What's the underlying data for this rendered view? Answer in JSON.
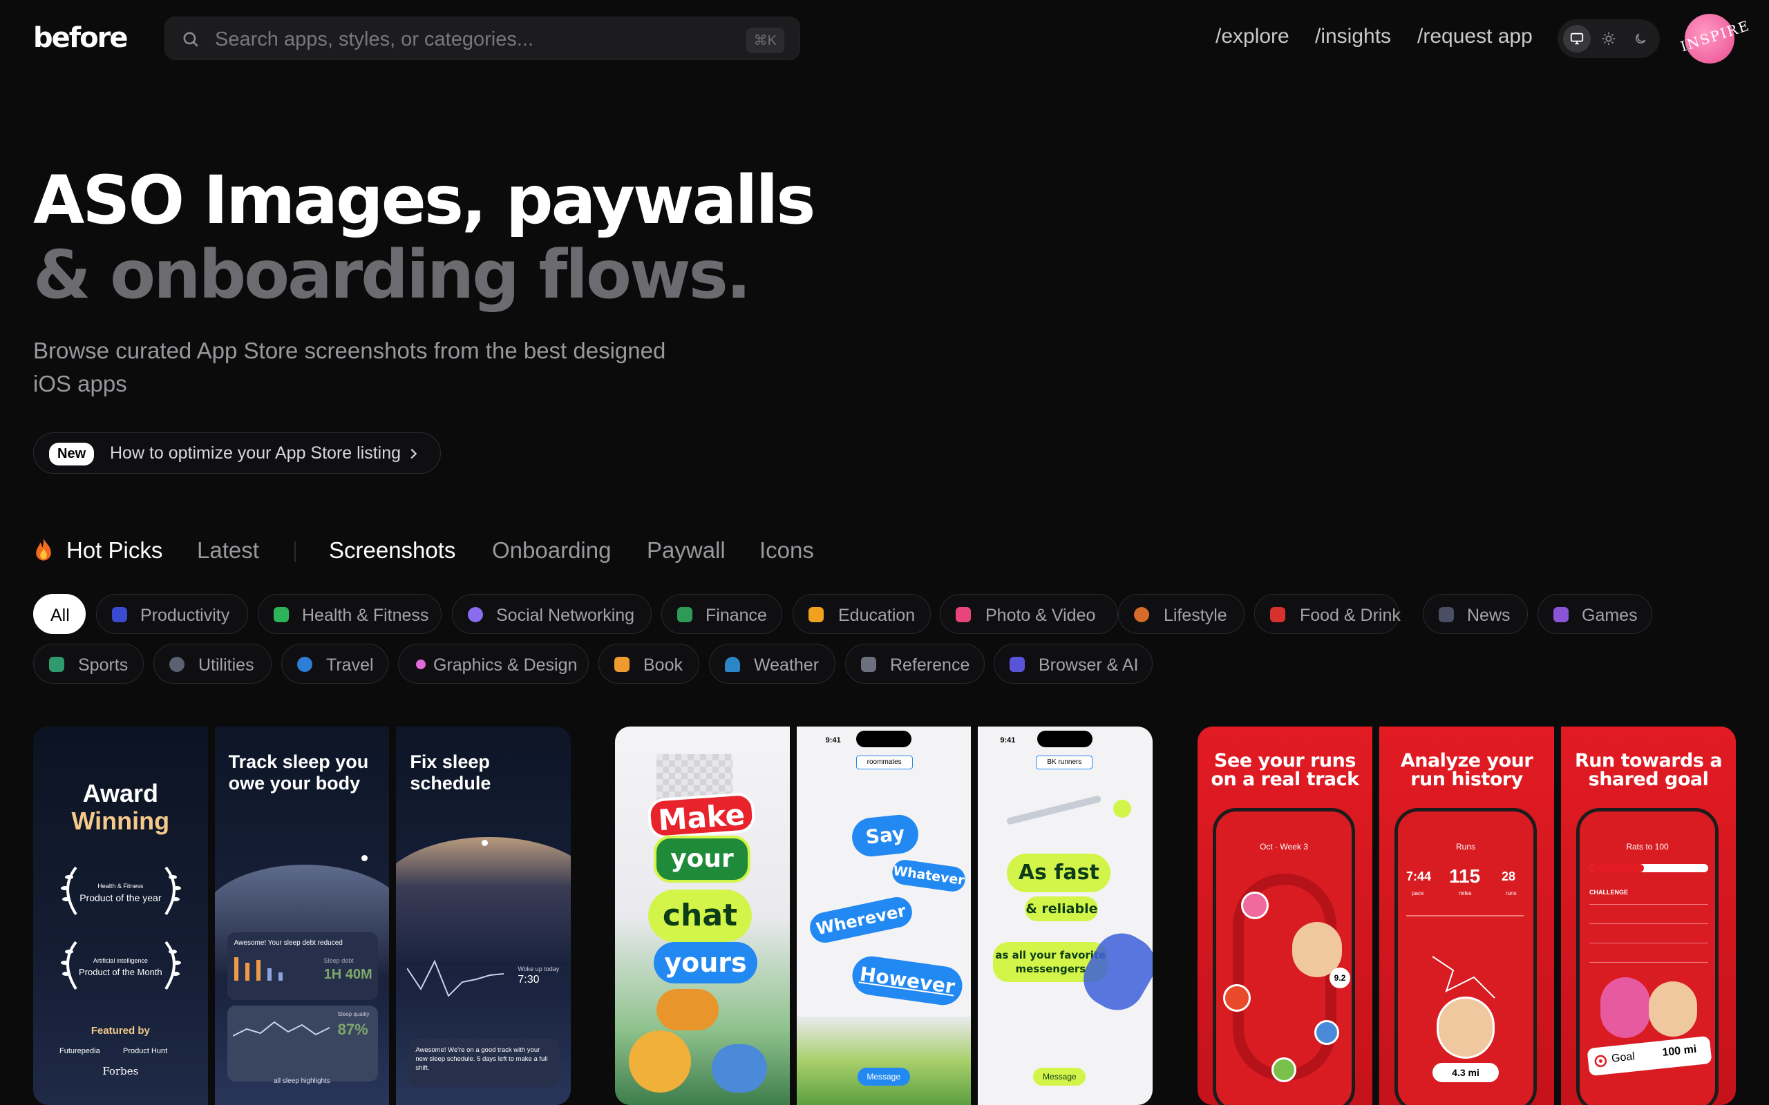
{
  "header": {
    "logo": "before",
    "search_placeholder": "Search apps, styles, or categories...",
    "shortcut": "⌘K",
    "nav": [
      "/explore",
      "/insights",
      "/request app"
    ],
    "avatar_text": "INSPIRE"
  },
  "hero": {
    "title_line1": "ASO Images, paywalls",
    "title_line2": "& onboarding flows.",
    "subtitle_line1": "Browse curated App Store screenshots from the best designed",
    "subtitle_line2": "iOS apps",
    "pill_badge": "New",
    "pill_text": "How to optimize your App Store listing"
  },
  "tabs": {
    "hot": "Hot Picks",
    "latest": "Latest",
    "screenshots": "Screenshots",
    "onboarding": "Onboarding",
    "paywall": "Paywall",
    "icons": "Icons"
  },
  "categories": {
    "all": "All",
    "productivity": "Productivity",
    "health": "Health & Fitness",
    "social": "Social Networking",
    "finance": "Finance",
    "education": "Education",
    "photo": "Photo & Video",
    "lifestyle": "Lifestyle",
    "food": "Food & Drink",
    "news": "News",
    "games": "Games",
    "sports": "Sports",
    "utilities": "Utilities",
    "travel": "Travel",
    "graphics": "Graphics & Design",
    "book": "Book",
    "weather": "Weather",
    "reference": "Reference",
    "browser": "Browser & AI"
  },
  "cards": {
    "sleep": {
      "award_line1": "Award",
      "award_line2": "Winning",
      "laurel1_small": "Health & Fitness",
      "laurel1_big": "Product of the year",
      "laurel2_small": "Artificial intelligence",
      "laurel2_big": "Product of the Month",
      "featured": "Featured by",
      "feat1": "Futurepedia",
      "feat2": "Product Hunt",
      "feat3": "Forbes",
      "p2_title_1": "Track sleep you",
      "p2_title_2": "owe your body",
      "p2_msg": "Awesome! Your sleep debt reduced",
      "p2_debt_label": "Sleep debt",
      "p2_debt": "1H 40M",
      "p2_quality_label": "Sleep quality",
      "p2_quality": "87%",
      "p2_highlights": "all sleep highlights",
      "p3_title_1": "Fix sleep",
      "p3_title_2": "schedule",
      "p3_wake": "Woke up today",
      "p3_time": "7:30",
      "p3_msg": "Awesome! We're on a good track with your new sleep schedule. 5 days left to make a full shift."
    },
    "chat": {
      "w1": "Make",
      "w2": "your",
      "w3": "chat",
      "w4": "yours",
      "time": "9:41",
      "group1": "roommates",
      "say": "Say",
      "whatever": "Whatever",
      "wherever": "Wherever",
      "however": "However",
      "message": "Message",
      "group2": "BK runners",
      "fast": "As fast",
      "reliable": "& reliable",
      "messengers_1": "as all your favorite",
      "messengers_2": "messengers"
    },
    "run": {
      "p1_title_1": "See your runs",
      "p1_title_2": "on a real track",
      "p1_week": "Oct · Week 3",
      "p1_score": "9.2",
      "p2_title_1": "Analyze your",
      "p2_title_2": "run history",
      "p2_runs": "Runs",
      "p2_pace": "7:44",
      "p2_miles": "115",
      "p2_count": "28",
      "p2_pace_l": "pace",
      "p2_miles_l": "miles",
      "p2_runs_l": "runs",
      "p2_dist": "4.3 mi",
      "p3_title_1": "Run towards a",
      "p3_title_2": "shared goal",
      "p3_header": "Rats to 100",
      "p3_challenge": "CHALLENGE",
      "p3_goal": "Goal",
      "p3_goal_val": "100 mi"
    }
  }
}
